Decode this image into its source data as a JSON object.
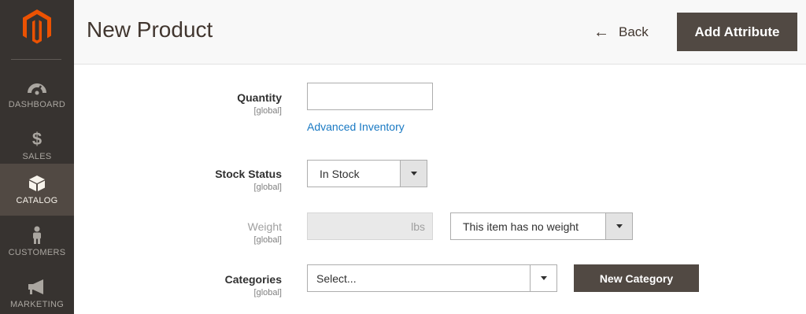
{
  "sidebar": {
    "logo": "magento-logo",
    "items": [
      {
        "label": "DASHBOARD",
        "icon": "speedometer-icon"
      },
      {
        "label": "SALES",
        "icon": "dollar-icon"
      },
      {
        "label": "CATALOG",
        "icon": "box-icon",
        "active": true
      },
      {
        "label": "CUSTOMERS",
        "icon": "person-icon"
      },
      {
        "label": "MARKETING",
        "icon": "megaphone-icon"
      }
    ]
  },
  "header": {
    "title": "New Product",
    "back_label": "Back",
    "back_icon": "arrow-left-icon",
    "add_attribute_label": "Add Attribute"
  },
  "form": {
    "quantity": {
      "label": "Quantity",
      "scope": "[global]",
      "value": "",
      "link": "Advanced Inventory"
    },
    "stock_status": {
      "label": "Stock Status",
      "scope": "[global]",
      "value": "In Stock"
    },
    "weight": {
      "label": "Weight",
      "scope": "[global]",
      "value": "",
      "unit": "lbs",
      "has_weight_value": "This item has no weight"
    },
    "categories": {
      "label": "Categories",
      "scope": "[global]",
      "placeholder": "Select...",
      "new_category_label": "New Category"
    }
  },
  "colors": {
    "sidebar_bg": "#373330",
    "sidebar_active": "#514943",
    "logo_orange": "#eb5202",
    "button_dark": "#514943",
    "link_blue": "#1979c3"
  }
}
